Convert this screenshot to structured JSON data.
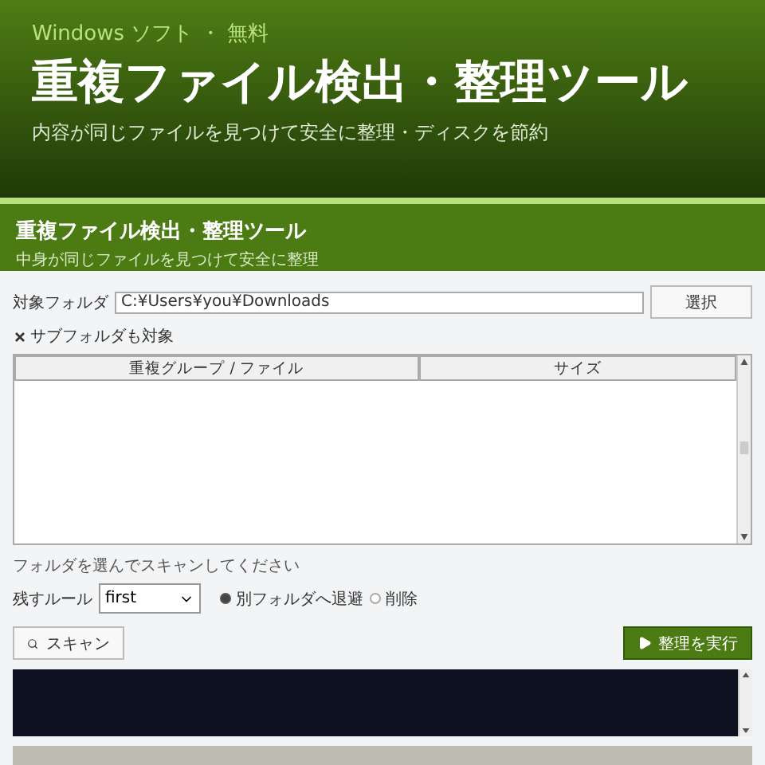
{
  "banner": {
    "eyebrow": "Windows ソフト ・ 無料",
    "title": "重複ファイル検出・整理ツール",
    "subtitle": "内容が同じファイルを見つけて安全に整理・ディスクを節約"
  },
  "app": {
    "title": "重複ファイル検出・整理ツール",
    "subtitle": "中身が同じファイルを見つけて安全に整理"
  },
  "folder": {
    "label": "対象フォルダ",
    "value": "C:¥Users¥you¥Downloads",
    "button": "選択"
  },
  "subfolders": {
    "label": "サブフォルダも対象",
    "checked": true
  },
  "table": {
    "columns": [
      "重複グループ / ファイル",
      "サイズ"
    ]
  },
  "status": "フォルダを選んでスキャンしてください",
  "rule": {
    "label": "残すルール",
    "value": "first"
  },
  "actions": [
    {
      "label": "別フォルダへ退避",
      "selected": true
    },
    {
      "label": "削除",
      "selected": false
    }
  ],
  "scan_button": "スキャン",
  "run_button": "整理を実行"
}
